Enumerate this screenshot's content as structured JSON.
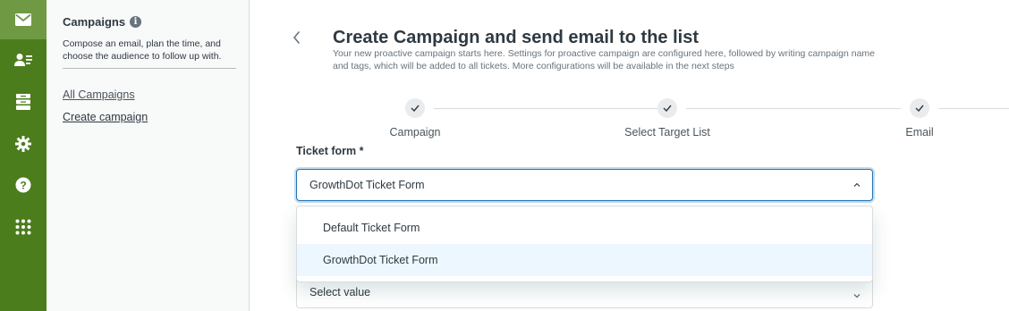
{
  "rail": {
    "items": [
      {
        "name": "campaigns-mail-icon",
        "active": true
      },
      {
        "name": "contacts-icon",
        "active": false
      },
      {
        "name": "archive-icon",
        "active": false
      },
      {
        "name": "settings-gear-icon",
        "active": false
      },
      {
        "name": "help-icon",
        "active": false
      },
      {
        "name": "apps-grid-icon",
        "active": false
      }
    ],
    "bg_color": "#4b7d1c",
    "active_color": "#6f9a43"
  },
  "sidebar": {
    "title": "Campaigns",
    "info_glyph": "i",
    "description": "Compose an email, plan the time, and choose the audience to follow up with.",
    "links": [
      {
        "label": "All Campaigns"
      },
      {
        "label": "Create campaign"
      }
    ]
  },
  "header": {
    "back_icon": "chevron-left-icon",
    "title": "Create Campaign and send email to the list",
    "subtitle": "Your new proactive campaign starts here. Settings for proactive campaign are configured here, followed by writing campaign name and tags, which will be added to all tickets. More configurations will be available in the next steps"
  },
  "stepper": {
    "steps": [
      {
        "label": "Campaign",
        "done": true
      },
      {
        "label": "Select Target List",
        "done": true
      },
      {
        "label": "Email",
        "done": true
      }
    ]
  },
  "form": {
    "ticket_form": {
      "label": "Ticket form *",
      "value": "GrowthDot Ticket Form",
      "expanded": true,
      "options": [
        {
          "label": "Default Ticket Form",
          "highlighted": false
        },
        {
          "label": "GrowthDot Ticket Form",
          "highlighted": true
        }
      ]
    },
    "next_select": {
      "value": "Select value"
    }
  },
  "colors": {
    "focus_border": "#1f73b7",
    "option_highlight": "#edf7ff"
  }
}
